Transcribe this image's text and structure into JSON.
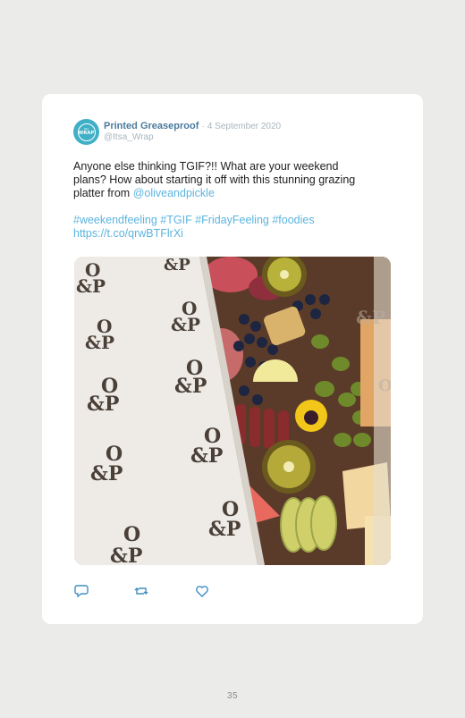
{
  "tweet": {
    "avatar_top": "itsa",
    "avatar_text": "WRAP",
    "display_name": "Printed Greaseproof",
    "separator": "·",
    "date": "4 September 2020",
    "handle": "@Itsa_Wrap",
    "text_line1": "Anyone else thinking TGIF?!! What are your weekend",
    "text_line2": "plans? How about starting it off with this stunning grazing",
    "text_line3_prefix": "platter from",
    "mention": "@oliveandpickle",
    "hashtags": "#weekendfeeling #TGIF #FridayFeeling #foodies",
    "short_link": "https://t.co/qrwBTFlrXi",
    "logo_text_top": "O",
    "logo_text_bottom": "&P"
  },
  "actions": {
    "reply_icon": "reply-icon",
    "retweet_icon": "retweet-icon",
    "like_icon": "heart-icon"
  },
  "colors": {
    "accent_link": "#5cb4df",
    "name": "#4a7a9c",
    "avatar": "#3fb0c6",
    "background": "#ebebea"
  },
  "page": {
    "number": "35"
  }
}
